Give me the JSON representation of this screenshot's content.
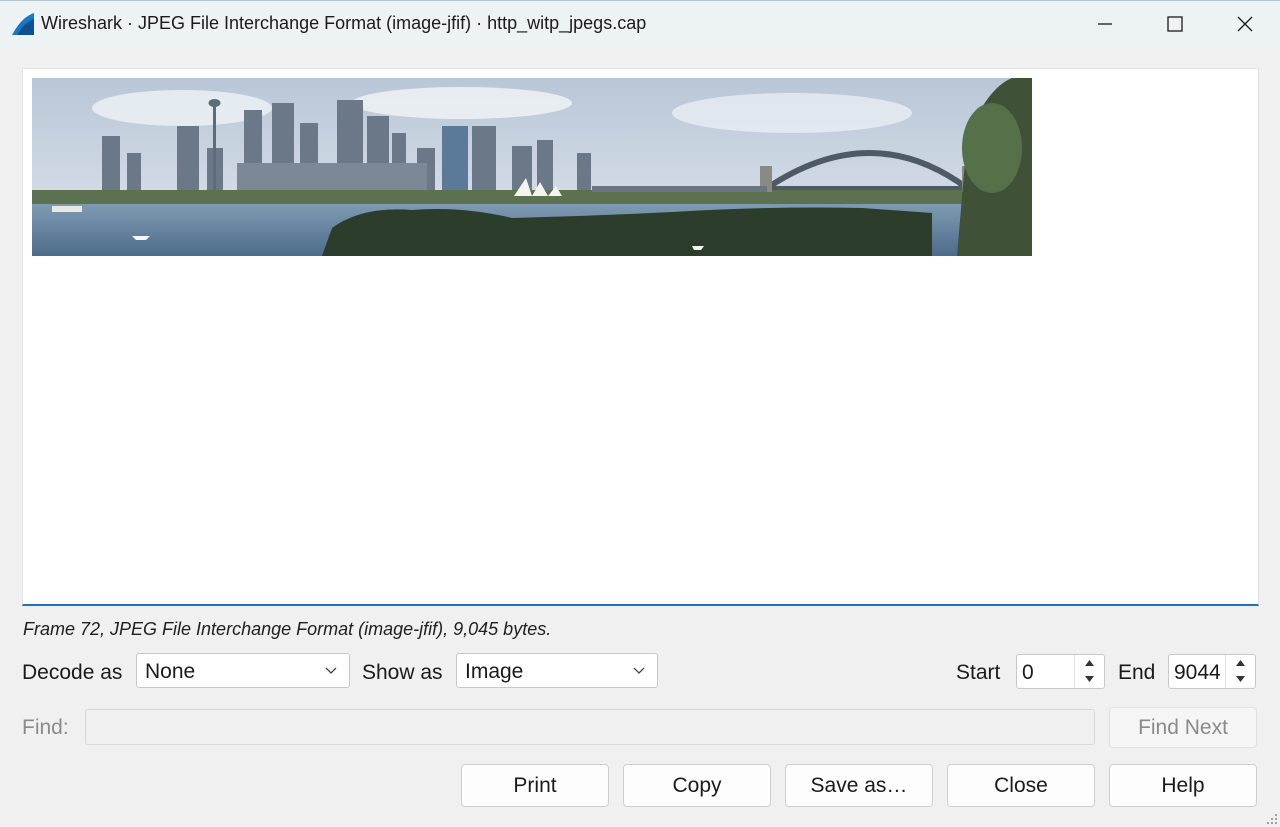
{
  "window": {
    "title": "Wireshark · JPEG File Interchange Format (image-jfif) · http_witp_jpegs.cap",
    "icons": {
      "app": "wireshark-fin-icon",
      "minimize": "minimize-icon",
      "maximize": "maximize-icon",
      "close": "close-icon"
    }
  },
  "viewer": {
    "image_description_name": "sydney-harbour-panorama"
  },
  "info": {
    "frame_text": "Frame 72, JPEG File Interchange Format (image-jfif), 9,045 bytes."
  },
  "controls": {
    "decode_label": "Decode as",
    "decode_value": "None",
    "show_label": "Show as",
    "show_value": "Image",
    "start_label": "Start",
    "start_value": "0",
    "end_label": "End",
    "end_value": "9044"
  },
  "find": {
    "label": "Find:",
    "value": "",
    "find_next_label": "Find Next"
  },
  "buttons": {
    "print": "Print",
    "copy": "Copy",
    "save_as": "Save as…",
    "close": "Close",
    "help": "Help"
  },
  "colors": {
    "accent": "#1e6ec8",
    "titlebar": "#edf2f5",
    "dialog_bg": "#f0f0f0"
  }
}
